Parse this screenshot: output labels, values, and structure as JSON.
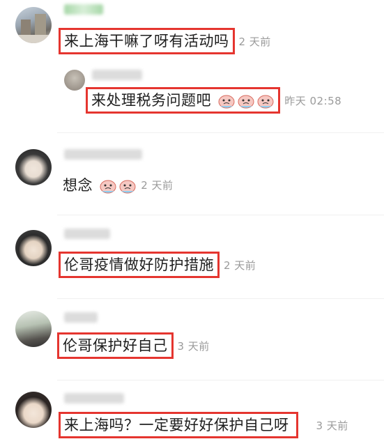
{
  "comments": [
    {
      "text": "来上海干嘛了呀有活动吗",
      "time": "2 天前"
    },
    {
      "text": "来处理税务问题吧",
      "time": "昨天 02:58",
      "emoji": "crying-face-emoji"
    },
    {
      "text": "想念",
      "time": "2 天前",
      "emoji": "crying-face-emoji"
    },
    {
      "text": "伦哥疫情做好防护措施",
      "time": "2 天前"
    },
    {
      "text": "伦哥保护好自己",
      "time": "3 天前"
    },
    {
      "text": "来上海吗？一定要好好保护自己呀",
      "time": "3 天前"
    }
  ],
  "colors": {
    "highlight": "#e5352f",
    "meta": "#9a9a9a",
    "text": "#1e1e1e"
  }
}
